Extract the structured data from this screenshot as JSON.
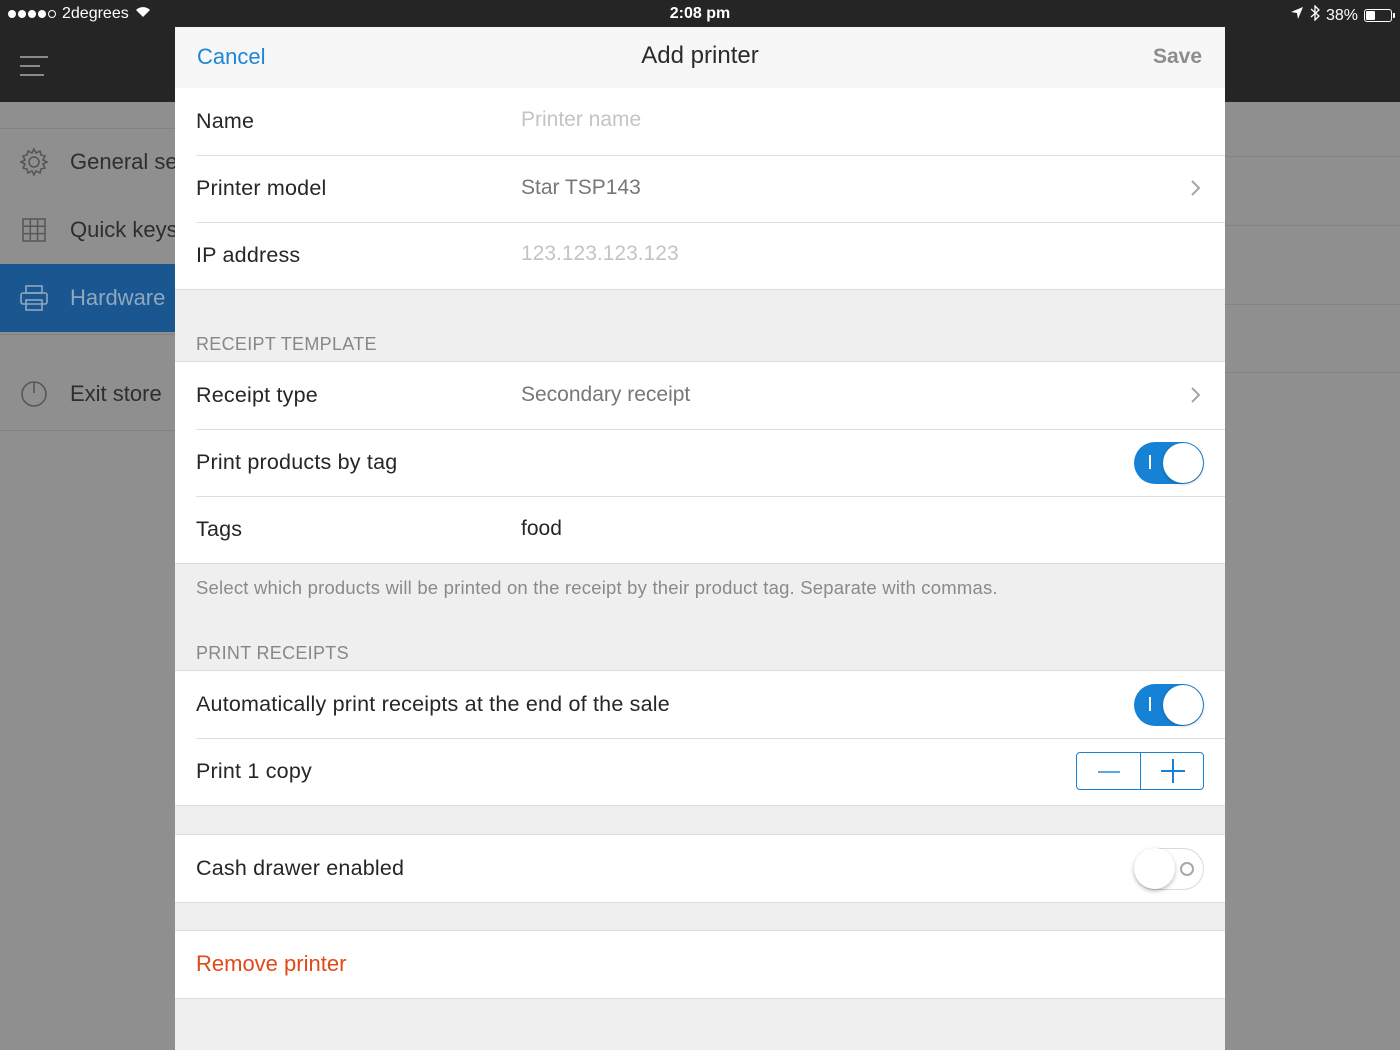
{
  "status_bar": {
    "carrier": "2degrees",
    "time": "2:08 pm",
    "battery": "38%"
  },
  "background": {
    "sidebar": {
      "items": [
        {
          "label": "General settings",
          "icon": "gear-icon"
        },
        {
          "label": "Quick keys",
          "icon": "grid-icon"
        },
        {
          "label": "Hardware",
          "icon": "printer-icon",
          "active": true
        },
        {
          "label": "Exit store",
          "icon": "power-icon"
        }
      ]
    }
  },
  "modal": {
    "nav": {
      "cancel_label": "Cancel",
      "title": "Add printer",
      "save_label": "Save"
    },
    "printer": {
      "name_label": "Name",
      "name_placeholder": "Printer name",
      "model_label": "Printer model",
      "model_value": "Star TSP143",
      "ip_label": "IP address",
      "ip_placeholder": "123.123.123.123"
    },
    "receipt_template": {
      "header": "RECEIPT TEMPLATE",
      "receipt_type_label": "Receipt type",
      "receipt_type_value": "Secondary receipt",
      "print_by_tag_label": "Print products by tag",
      "print_by_tag_on": true,
      "tags_label": "Tags",
      "tags_value": "food",
      "note": "Select which products will be printed on the receipt by their product tag. Separate with commas."
    },
    "print_receipts": {
      "header": "PRINT RECEIPTS",
      "auto_print_label": "Automatically print receipts at the end of the sale",
      "auto_print_on": true,
      "copies_label": "Print 1 copy",
      "copies": 1
    },
    "cash_drawer": {
      "label": "Cash drawer enabled",
      "enabled": false
    },
    "remove_label": "Remove printer"
  },
  "colors": {
    "accent": "#1582d6",
    "destructive": "#e04a17",
    "sidebar_active": "#1a5690"
  }
}
